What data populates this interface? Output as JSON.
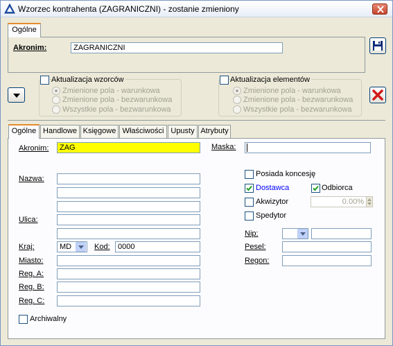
{
  "window": {
    "title": "Wzorzec kontrahenta (ZAGRANICZNI) - zostanie zmieniony",
    "app_icon": "triangle-app-icon",
    "close_icon": "close-icon"
  },
  "top": {
    "tab_label": "Ogólne",
    "akronim_label": "Akronim:",
    "akronim_value": "ZAGRANICZNI",
    "save_icon": "floppy-disk-icon",
    "cancel_icon": "red-x-icon",
    "expand_icon": "chevron-down-icon"
  },
  "update_patterns": {
    "label": "Aktualizacja wzorców",
    "options": [
      "Zmienione pola - warunkowa",
      "Zmienione pola - bezwarunkowa",
      "Wszystkie pola - bezwarunkowa"
    ],
    "selected": 0
  },
  "update_elements": {
    "label": "Aktualizacja elementów",
    "options": [
      "Zmienione pola - warunkowa",
      "Zmienione pola - bezwarunkowa",
      "Wszystkie pola - bezwarunkowa"
    ],
    "selected": 0
  },
  "tabs": [
    "Ogólne",
    "Handlowe",
    "Księgowe",
    "Właściwości",
    "Upusty",
    "Atrybuty"
  ],
  "form": {
    "akronim_label": "Akronim:",
    "akronim_value": "ZAG",
    "maska_label": "Maska:",
    "maska_value": "",
    "nazwa_label": "Nazwa:",
    "ulica_label": "Ulica:",
    "kraj_label": "Kraj:",
    "kraj_value": "MD",
    "kod_label": "Kod:",
    "kod_value": "0000",
    "miasto_label": "Miasto:",
    "rega_label": "Reg. A:",
    "regb_label": "Reg. B:",
    "regc_label": "Reg. C:",
    "archiwalny_label": "Archiwalny",
    "posiada_koncesje_label": "Posiada koncesję",
    "dostawca_label": "Dostawca",
    "odbiorca_label": "Odbiorca",
    "akwizytor_label": "Akwizytor",
    "akwizytor_value": "0.00%",
    "spedytor_label": "Spedytor",
    "nip_label": "Nip:",
    "pesel_label": "Pesel:",
    "regon_label": "Regon:"
  },
  "colors": {
    "active_tab_accent": "#e68b2c",
    "highlight_field": "#ffff00",
    "dostawca_text": "#0000ff"
  }
}
